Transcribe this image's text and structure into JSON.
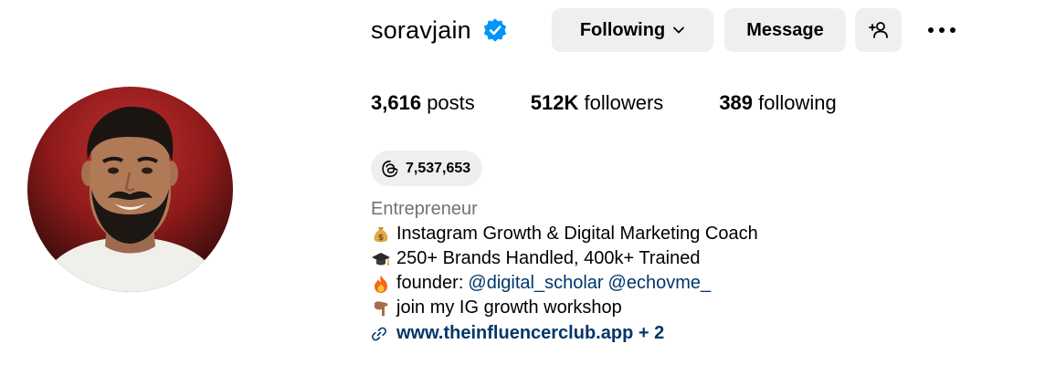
{
  "profile": {
    "username": "soravjain",
    "verified_icon": "verified-badge-icon",
    "avatar_icon": "profile-photo"
  },
  "actions": {
    "following_label": "Following",
    "message_label": "Message",
    "add_user_icon": "add-person-icon",
    "more_icon": "ellipsis-icon"
  },
  "stats": {
    "posts_count": "3,616",
    "posts_label": "posts",
    "followers_count": "512K",
    "followers_label": "followers",
    "following_count": "389",
    "following_label": "following"
  },
  "threads": {
    "icon": "threads-icon",
    "count": "7,537,653"
  },
  "bio": {
    "category": "Entrepreneur",
    "line1": "Instagram Growth & Digital Marketing Coach",
    "line2": "250+ Brands Handled, 400k+ Trained",
    "line3_prefix": "founder:",
    "mention1": "@digital_scholar",
    "mention2": "@echovme_",
    "line4": "join my IG growth workshop",
    "link_text": "www.theinfluencerclub.app + 2"
  },
  "colors": {
    "button_bg": "#efefef",
    "verified_blue": "#0095f6",
    "link_blue": "#00376b",
    "category_gray": "#737373"
  }
}
